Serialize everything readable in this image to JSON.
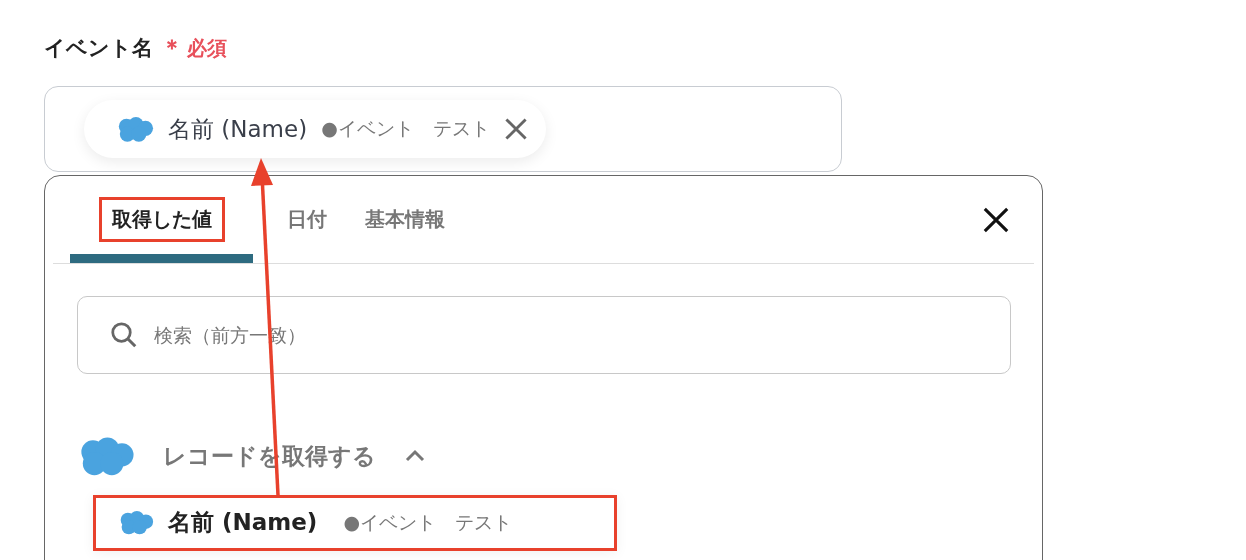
{
  "field": {
    "label": "イベント名",
    "required_mark": "＊",
    "required_text": "必須",
    "chip": {
      "name": "名前 (Name)",
      "meta": "●イベント　テスト"
    }
  },
  "panel": {
    "tabs": [
      {
        "label": "取得した値",
        "selected": true,
        "highlighted": true
      },
      {
        "label": "日付",
        "selected": false,
        "highlighted": false
      },
      {
        "label": "基本情報",
        "selected": false,
        "highlighted": false
      }
    ],
    "search": {
      "placeholder": "検索（前方一致）"
    },
    "group": {
      "title": "レコードを取得する",
      "expanded": true,
      "items": [
        {
          "name": "名前 (Name)",
          "meta": "●イベント　テスト",
          "highlighted": true
        }
      ]
    }
  }
}
